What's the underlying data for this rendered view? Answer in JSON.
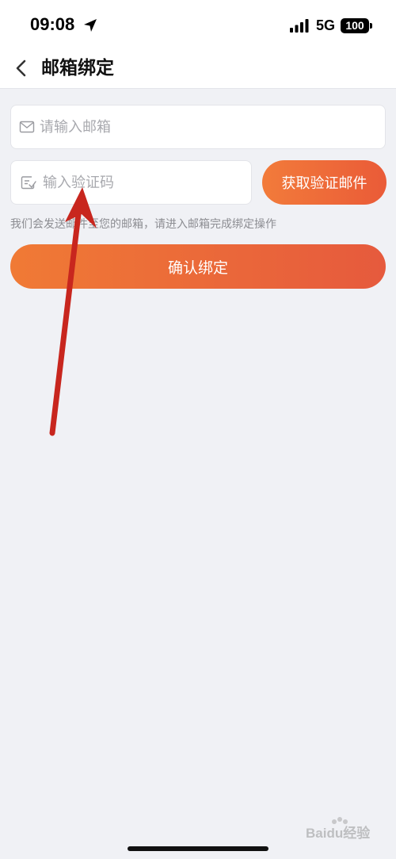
{
  "status_bar": {
    "time": "09:08",
    "network": "5G",
    "battery": "100"
  },
  "nav": {
    "title": "邮箱绑定"
  },
  "form": {
    "email_placeholder": "请输入邮箱",
    "code_placeholder": "输入验证码",
    "send_button_label": "获取验证邮件",
    "hint": "我们会发送邮件至您的邮箱，请进入邮箱完成绑定操作",
    "confirm_button_label": "确认绑定"
  },
  "watermark": {
    "text": "Baidu经验"
  },
  "colors": {
    "accent_start": "#f27b3a",
    "accent_end": "#ea5b38",
    "annotation_arrow": "#c8261e",
    "page_background": "#f0f1f5"
  },
  "annotation": {
    "type": "arrow",
    "target": "code-input"
  }
}
